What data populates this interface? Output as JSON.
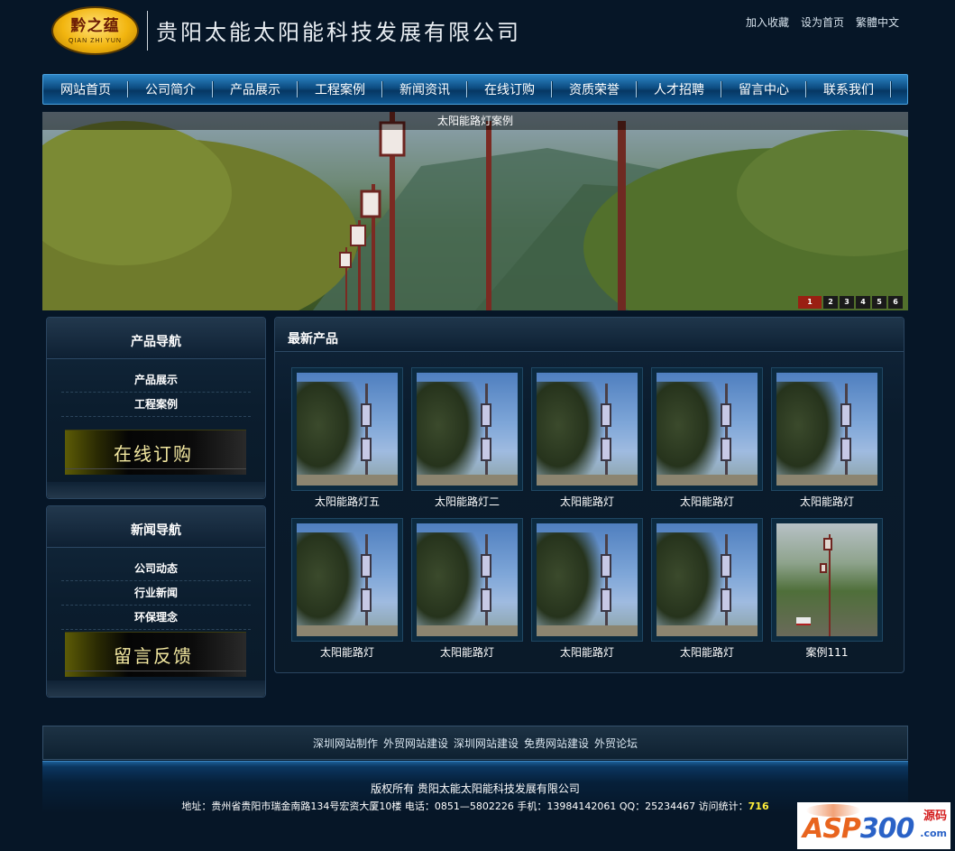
{
  "header": {
    "logo_cn": "黔之蕴",
    "logo_en": "QIAN ZHI YUN",
    "company_name": "贵阳太能太阳能科技发展有限公司",
    "top_links": [
      "加入收藏",
      "设为首页",
      "繁體中文"
    ]
  },
  "nav": {
    "items": [
      "网站首页",
      "公司简介",
      "产品展示",
      "工程案例",
      "新闻资讯",
      "在线订购",
      "资质荣誉",
      "人才招聘",
      "留言中心",
      "联系我们"
    ]
  },
  "banner": {
    "caption": "太阳能路灯案例",
    "pages": [
      "1",
      "2",
      "3",
      "4",
      "5",
      "6"
    ],
    "active_page": "1"
  },
  "product_nav": {
    "title": "产品导航",
    "links": [
      "产品展示",
      "工程案例"
    ],
    "promo": "在线订购"
  },
  "news_nav": {
    "title": "新闻导航",
    "links": [
      "公司动态",
      "行业新闻",
      "环保理念"
    ],
    "promo": "留言反馈"
  },
  "latest_products": {
    "title": "最新产品",
    "items": [
      {
        "label": "太阳能路灯五"
      },
      {
        "label": "太阳能路灯二"
      },
      {
        "label": "太阳能路灯"
      },
      {
        "label": "太阳能路灯"
      },
      {
        "label": "太阳能路灯"
      },
      {
        "label": "太阳能路灯"
      },
      {
        "label": "太阳能路灯"
      },
      {
        "label": "太阳能路灯"
      },
      {
        "label": "太阳能路灯"
      },
      {
        "label": "案例111"
      }
    ]
  },
  "footer": {
    "links": [
      "深圳网站制作",
      "外贸网站建设",
      "深圳网站建设",
      "免费网站建设",
      "外贸论坛"
    ],
    "copyright": "版权所有 贵阳太能太阳能科技发展有限公司",
    "address": "地址：贵州省贵阳市瑞金南路134号宏资大厦10楼 电话：0851—5802226 手机：13984142061 QQ：25234467 访问统计：",
    "visit_count": "716"
  },
  "watermark": {
    "brand_a": "ASP",
    "brand_b": "300",
    "cn": "源码",
    "com": ".com"
  }
}
